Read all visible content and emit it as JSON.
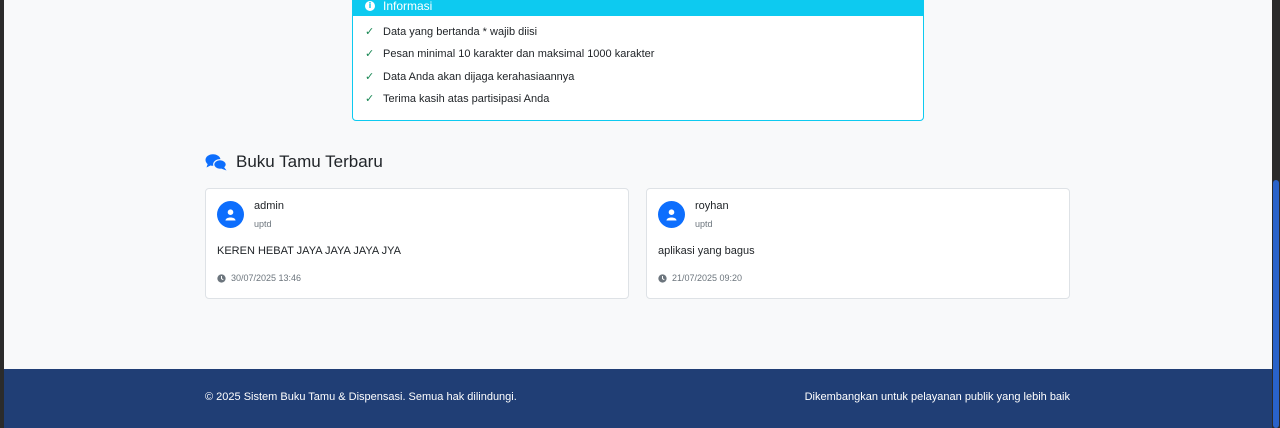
{
  "info": {
    "header": "Informasi",
    "items": [
      "Data yang bertanda * wajib diisi",
      "Pesan minimal 10 karakter dan maksimal 1000 karakter",
      "Data Anda akan dijaga kerahasiaannya",
      "Terima kasih atas partisipasi Anda"
    ]
  },
  "guestbook": {
    "title": "Buku Tamu Terbaru",
    "entries": [
      {
        "name": "admin",
        "role": "uptd",
        "message": "KEREN HEBAT JAYA JAYA JAYA JYA",
        "time": "30/07/2025 13:46"
      },
      {
        "name": "royhan",
        "role": "uptd",
        "message": "aplikasi yang bagus",
        "time": "21/07/2025 09:20"
      }
    ]
  },
  "footer": {
    "copyright": "© 2025 Sistem Buku Tamu & Dispensasi. Semua hak dilindungi.",
    "tagline": "Dikembangkan untuk pelayanan publik yang lebih baik"
  },
  "colors": {
    "info": "#0dcaf0",
    "primary": "#0d6efd",
    "success": "#198754",
    "footer": "#203e75"
  }
}
